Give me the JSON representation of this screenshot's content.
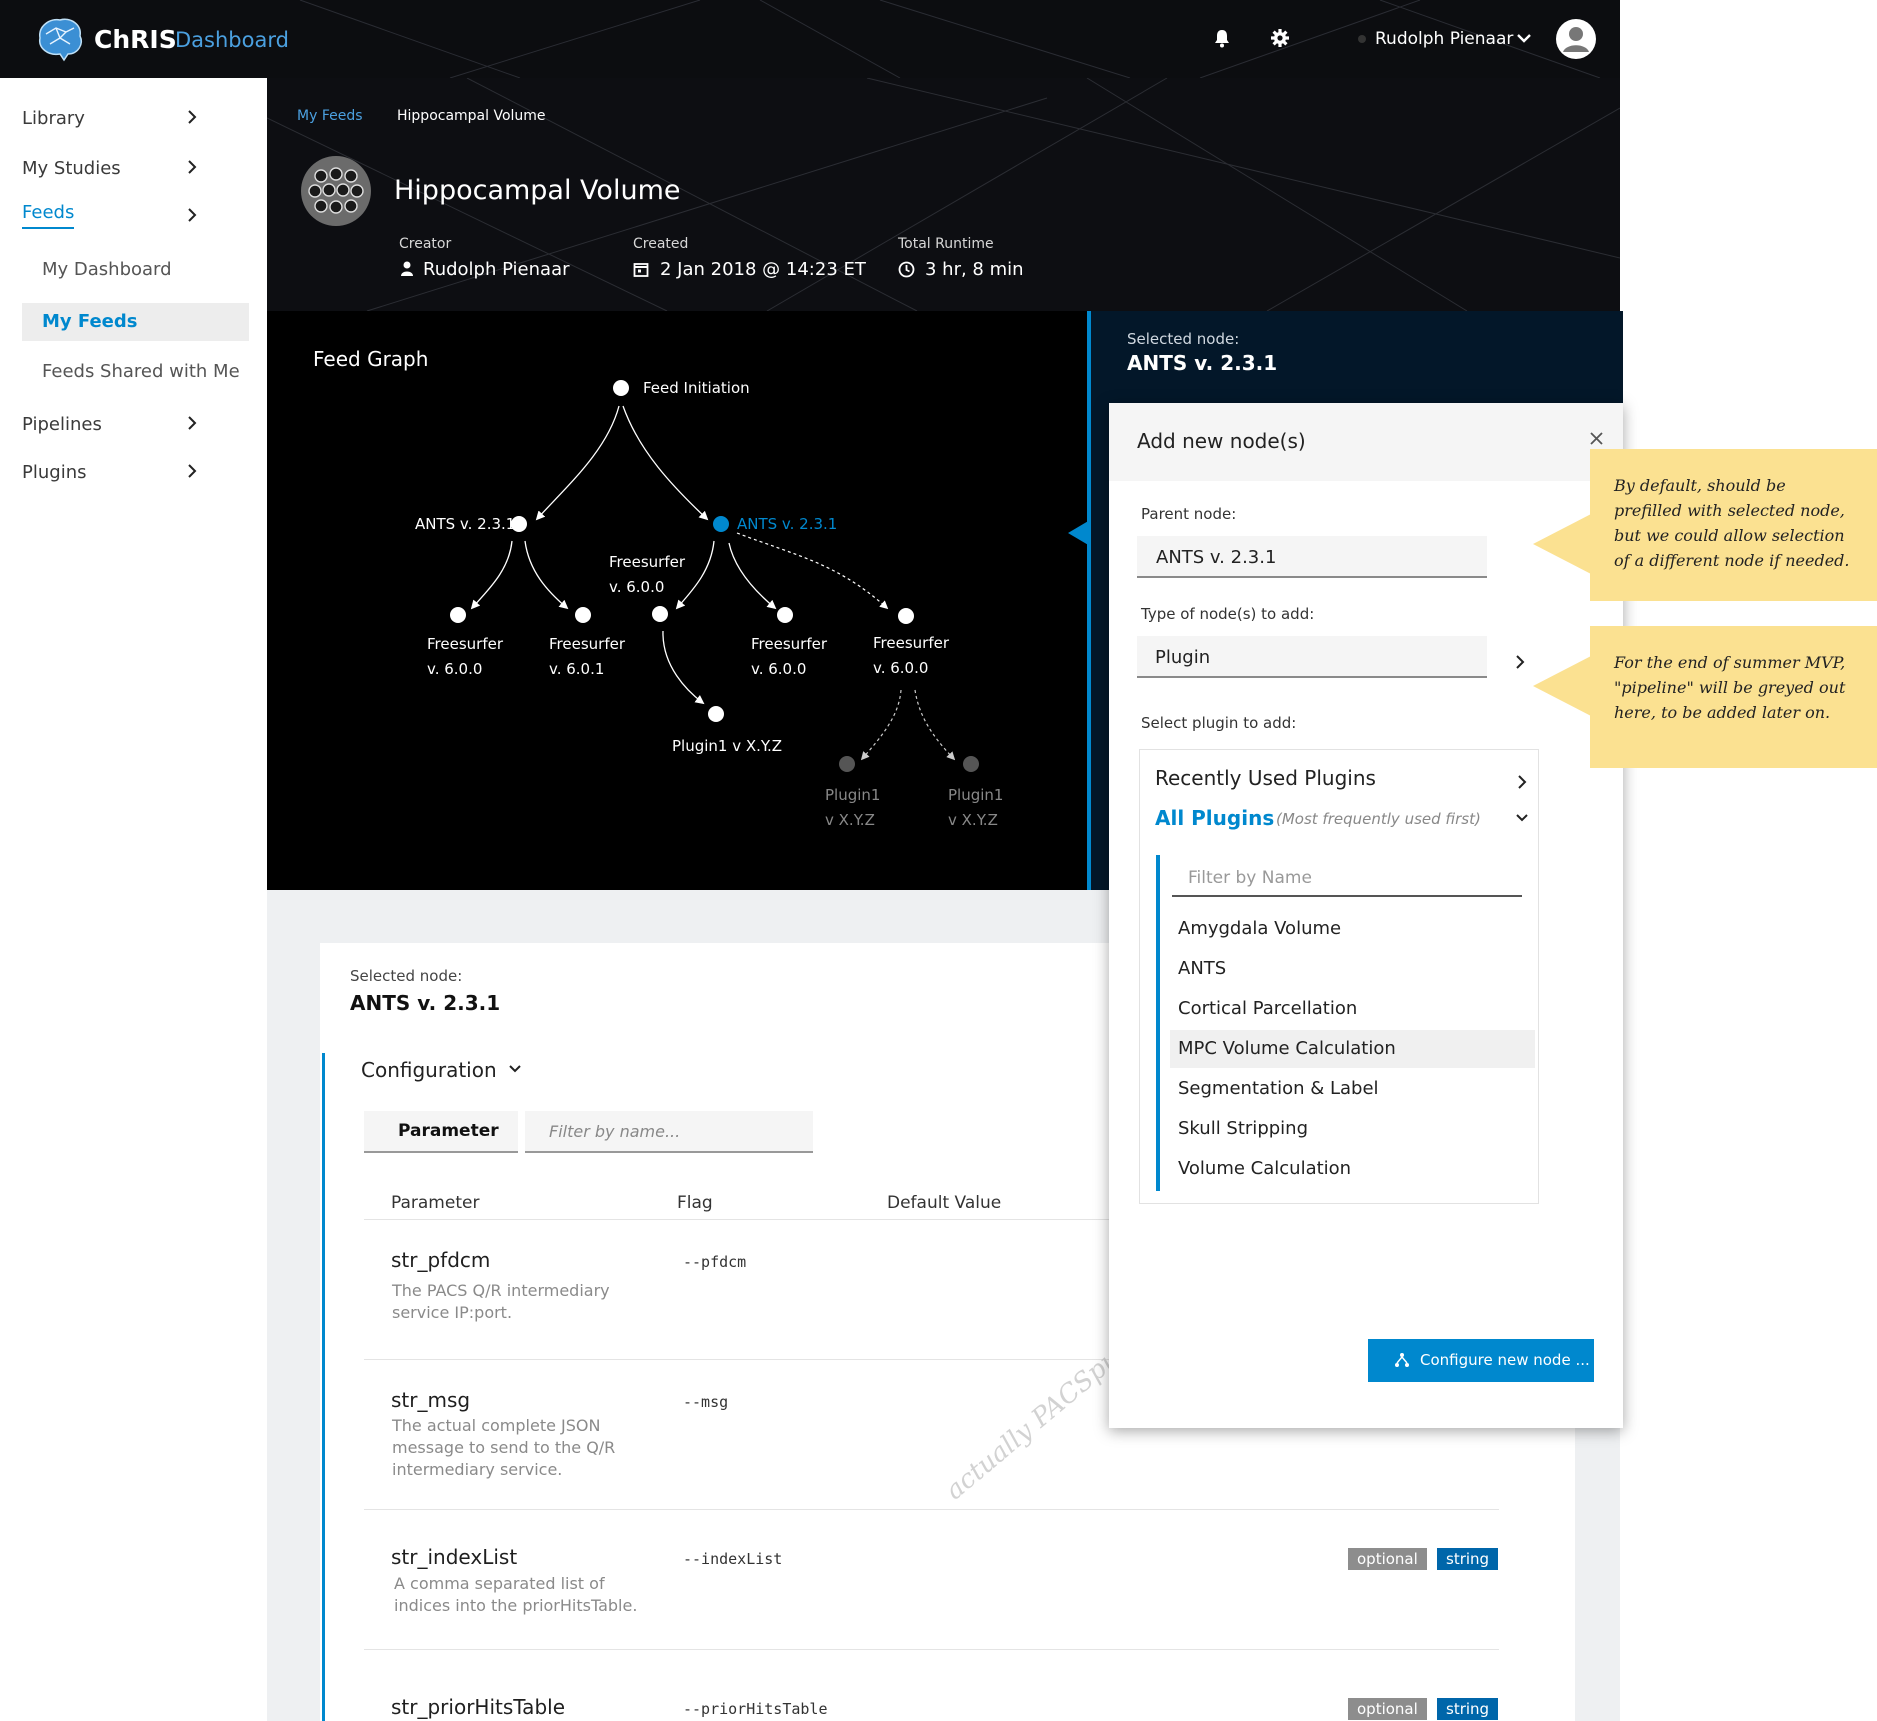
{
  "app": {
    "name": "ChRIS",
    "subtitle": "Dashboard",
    "user_name": "Rudolph Pienaar"
  },
  "sidebar": {
    "items": [
      {
        "label": "Library"
      },
      {
        "label": "My Studies"
      },
      {
        "label": "Feeds"
      },
      {
        "label": "Pipelines"
      },
      {
        "label": "Plugins"
      }
    ],
    "feeds_sub": [
      {
        "label": "My Dashboard"
      },
      {
        "label": "My Feeds"
      },
      {
        "label": "Feeds Shared with Me"
      }
    ]
  },
  "breadcrumb": {
    "parent": "My Feeds",
    "current": "Hippocampal Volume"
  },
  "feed": {
    "title": "Hippocampal Volume",
    "creator_label": "Creator",
    "creator": "Rudolph Pienaar",
    "created_label": "Created",
    "created": "2 Jan 2018 @ 14:23 ET",
    "runtime_label": "Total Runtime",
    "runtime": "3 hr, 8 min"
  },
  "graph": {
    "title": "Feed Graph",
    "nodes": {
      "root": "Feed Initiation",
      "ants_left": "ANTS v. 2.3.1",
      "ants_right": "ANTS v. 2.3.1",
      "fs_mid_l1": "Freesurfer",
      "fs_mid_l2": "v. 6.0.0",
      "fs1_l1": "Freesurfer",
      "fs1_l2": "v. 6.0.0",
      "fs2_l1": "Freesurfer",
      "fs2_l2": "v. 6.0.1",
      "fs3_l1": "Freesurfer",
      "fs3_l2": "v. 6.0.0",
      "fs4_l1": "Freesurfer",
      "fs4_l2": "v. 6.0.0",
      "plugin_a": "Plugin1 v X.Y.Z",
      "plugin_b_l1": "Plugin1",
      "plugin_b_l2": "v X.Y.Z",
      "plugin_c_l1": "Plugin1",
      "plugin_c_l2": "v X.Y.Z"
    }
  },
  "selected_node": {
    "label": "Selected node:",
    "name": "ANTS v. 2.3.1"
  },
  "configuration": {
    "title": "Configuration",
    "tab": "Parameter",
    "filter_placeholder": "Filter by name...",
    "columns": [
      "Parameter",
      "Flag",
      "Default Value"
    ],
    "rows": [
      {
        "name": "str_pfdcm",
        "desc": "The PACS Q/R intermediary service IP:port.",
        "flag": "--pfdcm"
      },
      {
        "name": "str_msg",
        "desc": "The actual complete JSON message to send to the Q/R intermediary service.",
        "flag": "--msg"
      },
      {
        "name": "str_indexList",
        "desc": "A comma separated list of indices into the priorHitsTable.",
        "flag": "--indexList",
        "badges": [
          "optional",
          "string"
        ]
      },
      {
        "name": "str_priorHitsTable",
        "desc": "",
        "flag": "--priorHitsTable",
        "badges": [
          "optional",
          "string"
        ]
      }
    ],
    "watermark": "actually PACSpull parameters :) )"
  },
  "modal": {
    "title": "Add new node(s)",
    "parent_label": "Parent node:",
    "parent_value": "ANTS v. 2.3.1",
    "type_label": "Type of node(s) to add:",
    "type_value": "Plugin",
    "select_label": "Select plugin to add:",
    "recent_label": "Recently Used Plugins",
    "all_label": "All Plugins",
    "all_hint": "(Most frequently used first)",
    "filter_placeholder": "Filter by Name",
    "plugins": [
      "Amygdala Volume",
      "ANTS",
      "Cortical Parcellation",
      "MPC Volume Calculation",
      "Segmentation & Label",
      "Skull Stripping",
      "Volume Calculation"
    ],
    "configure_button": "Configure new node ..."
  },
  "notes": [
    "By default, should be prefilled with selected node, but we could allow selection of a different node if needed.",
    "For the end of summer MVP, \"pipeline\" will be greyed out here, to be added later on."
  ],
  "colors": {
    "accent": "#0088ce",
    "note": "#fbe191",
    "dark": "#000000",
    "panel": "#031729"
  }
}
